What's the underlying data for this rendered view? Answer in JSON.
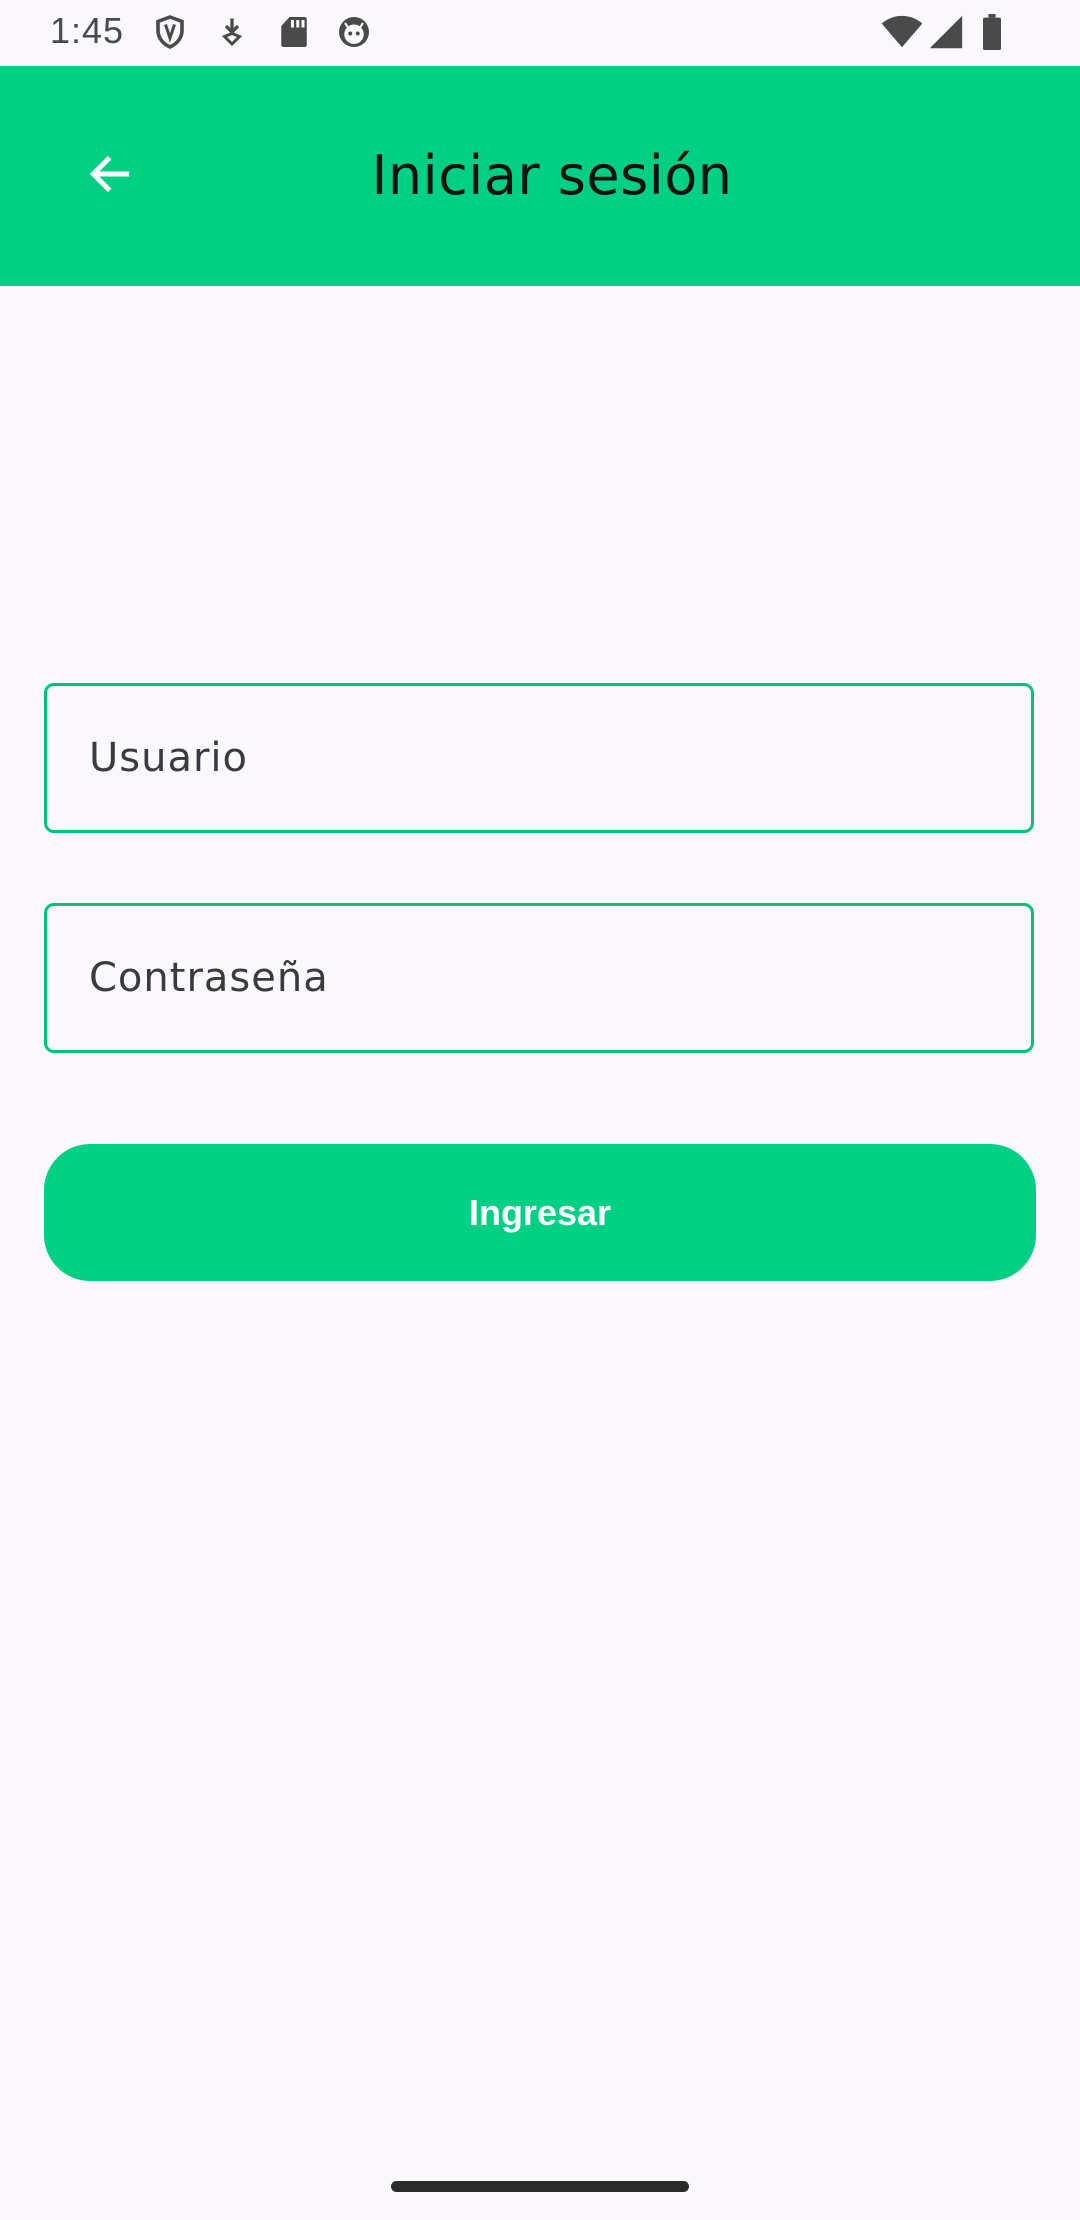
{
  "status_bar": {
    "time": "1:45",
    "icons": [
      "shield-icon",
      "download-icon",
      "sd-card-icon",
      "cat-face-icon",
      "wifi-icon",
      "signal-icon",
      "battery-icon"
    ]
  },
  "app_bar": {
    "title": "Iniciar sesión",
    "back_icon": "arrow-back-icon",
    "color": "#00d084"
  },
  "form": {
    "username": {
      "placeholder": "Usuario",
      "value": ""
    },
    "password": {
      "placeholder": "Contraseña",
      "value": ""
    },
    "submit_label": "Ingresar"
  },
  "colors": {
    "accent": "#00d084",
    "field_border": "#00c27a",
    "background": "#fbf8fd"
  }
}
